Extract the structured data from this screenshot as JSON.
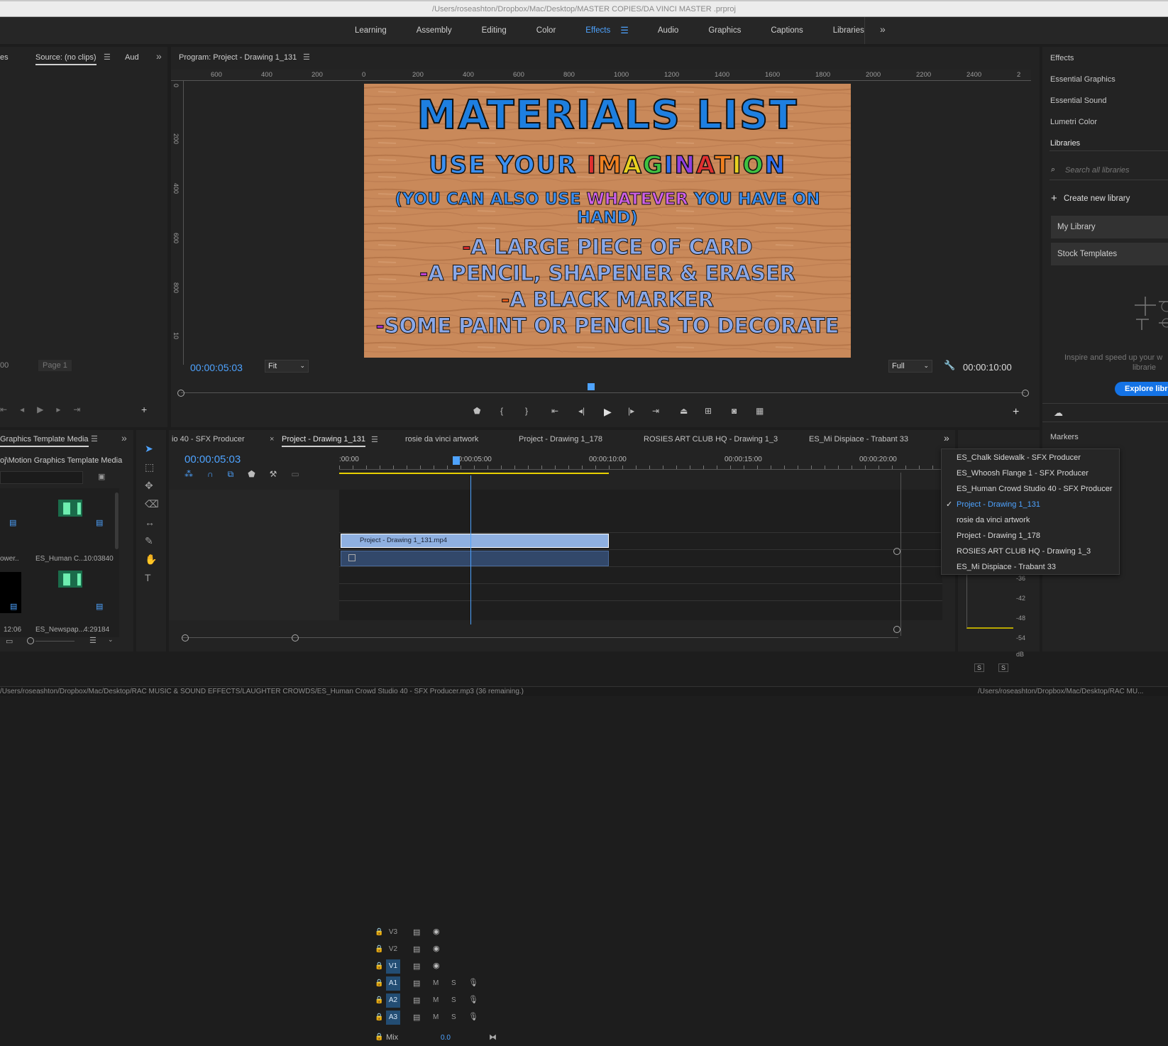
{
  "window": {
    "path": "/Users/roseashton/Dropbox/Mac/Desktop/MASTER COPIES/DA VINCI MASTER .prproj"
  },
  "workspaces": [
    "Learning",
    "Assembly",
    "Editing",
    "Color",
    "Effects",
    "Audio",
    "Graphics",
    "Captions",
    "Libraries"
  ],
  "active_workspace": "Effects",
  "source": {
    "left_tab": "es",
    "tab": "Source: (no clips)",
    "aud": "Aud",
    "page": "Page 1",
    "tc_left": "00"
  },
  "program": {
    "title": "Program: Project - Drawing 1_131",
    "timecode": "00:00:05:03",
    "zoom": "Fit",
    "quality": "Full",
    "duration": "00:00:10:00",
    "ruler": [
      "600",
      "400",
      "200",
      "0",
      "200",
      "400",
      "600",
      "800",
      "1000",
      "1200",
      "1400",
      "1600",
      "1800",
      "2000",
      "2200",
      "2400",
      "2"
    ],
    "vruler": [
      "0",
      "200",
      "400",
      "600",
      "800",
      "10"
    ]
  },
  "frame": {
    "title": "MATERIALS LIST",
    "line1a": "USE YOUR",
    "line1b": "IMAGINATION",
    "line2a": "(YOU CAN ALSO USE",
    "line2b": "WHATEVER",
    "line2c": "YOU HAVE ON HAND)",
    "items": [
      "A LARGE  PIECE OF CARD",
      "A PENCIL, SHAPENER &  ERASER",
      "A BLACK MARKER",
      "SOME PAINT OR PENCILS TO DECORATE"
    ],
    "dashes": [
      "#d42a2a",
      "#c040d0",
      "#e05a1a",
      "#a030c8"
    ]
  },
  "project": {
    "title": "Graphics Template Media",
    "path": "oj\\Motion Graphics Template Media",
    "items": [
      {
        "name": "ower..",
        "dur": ""
      },
      {
        "name": "ES_Human C...",
        "dur": "10:03840"
      },
      {
        "name": "",
        "dur": "12:06"
      },
      {
        "name": "ES_Newspap...",
        "dur": "4:29184"
      }
    ]
  },
  "timeline": {
    "tabs": [
      "io 40 - SFX Producer",
      "Project - Drawing 1_131",
      "rosie da vinci artwork",
      "Project - Drawing 1_178",
      "ROSIES ART CLUB HQ - Drawing 1_3",
      "ES_Mi Dispiace - Trabant 33"
    ],
    "timecode": "00:00:05:03",
    "ruler": [
      ":00:00",
      "00:00:05:00",
      "00:00:10:00",
      "00:00:15:00",
      "00:00:20:00"
    ],
    "tracks": [
      "V3",
      "V2",
      "V1",
      "A1",
      "A2",
      "A3"
    ],
    "mix": "Mix",
    "mix_val": "0.0",
    "clip": "Project - Drawing 1_131.mp4"
  },
  "dropdown": [
    "ES_Chalk Sidewalk - SFX Producer",
    "ES_Whoosh Flange 1 - SFX Producer",
    "ES_Human Crowd Studio 40 - SFX Producer",
    "Project - Drawing 1_131",
    "rosie da vinci artwork",
    "Project - Drawing 1_178",
    "ROSIES ART CLUB HQ - Drawing 1_3",
    "ES_Mi Dispiace - Trabant 33"
  ],
  "dropdown_selected": 3,
  "right": {
    "items": [
      "Effects",
      "Essential Graphics",
      "Essential Sound",
      "Lumetri Color",
      "Libraries"
    ],
    "search": "Search all libraries",
    "create": "Create new library",
    "libs": [
      "My Library",
      "Stock Templates"
    ],
    "inspire": "Inspire and speed up your w",
    "inspire2": "librarie",
    "explore": "Explore libr",
    "markers": "Markers"
  },
  "meter": {
    "labels": [
      "-36",
      "-42",
      "-48",
      "-54",
      "dB"
    ],
    "s": "S"
  },
  "status": {
    "left": "/Users/roseashton/Dropbox/Mac/Desktop/RAC MUSIC & SOUND EFFECTS/LAUGHTER CROWDS/ES_Human Crowd Studio 40 - SFX Producer.mp3 (36 remaining.)",
    "right": "/Users/roseashton/Dropbox/Mac/Desktop/RAC MU..."
  },
  "colors": {
    "accent": "#4ea3ff",
    "clip": "#8fb0e0",
    "audio": "#32486a",
    "inout": "#e8d000"
  }
}
